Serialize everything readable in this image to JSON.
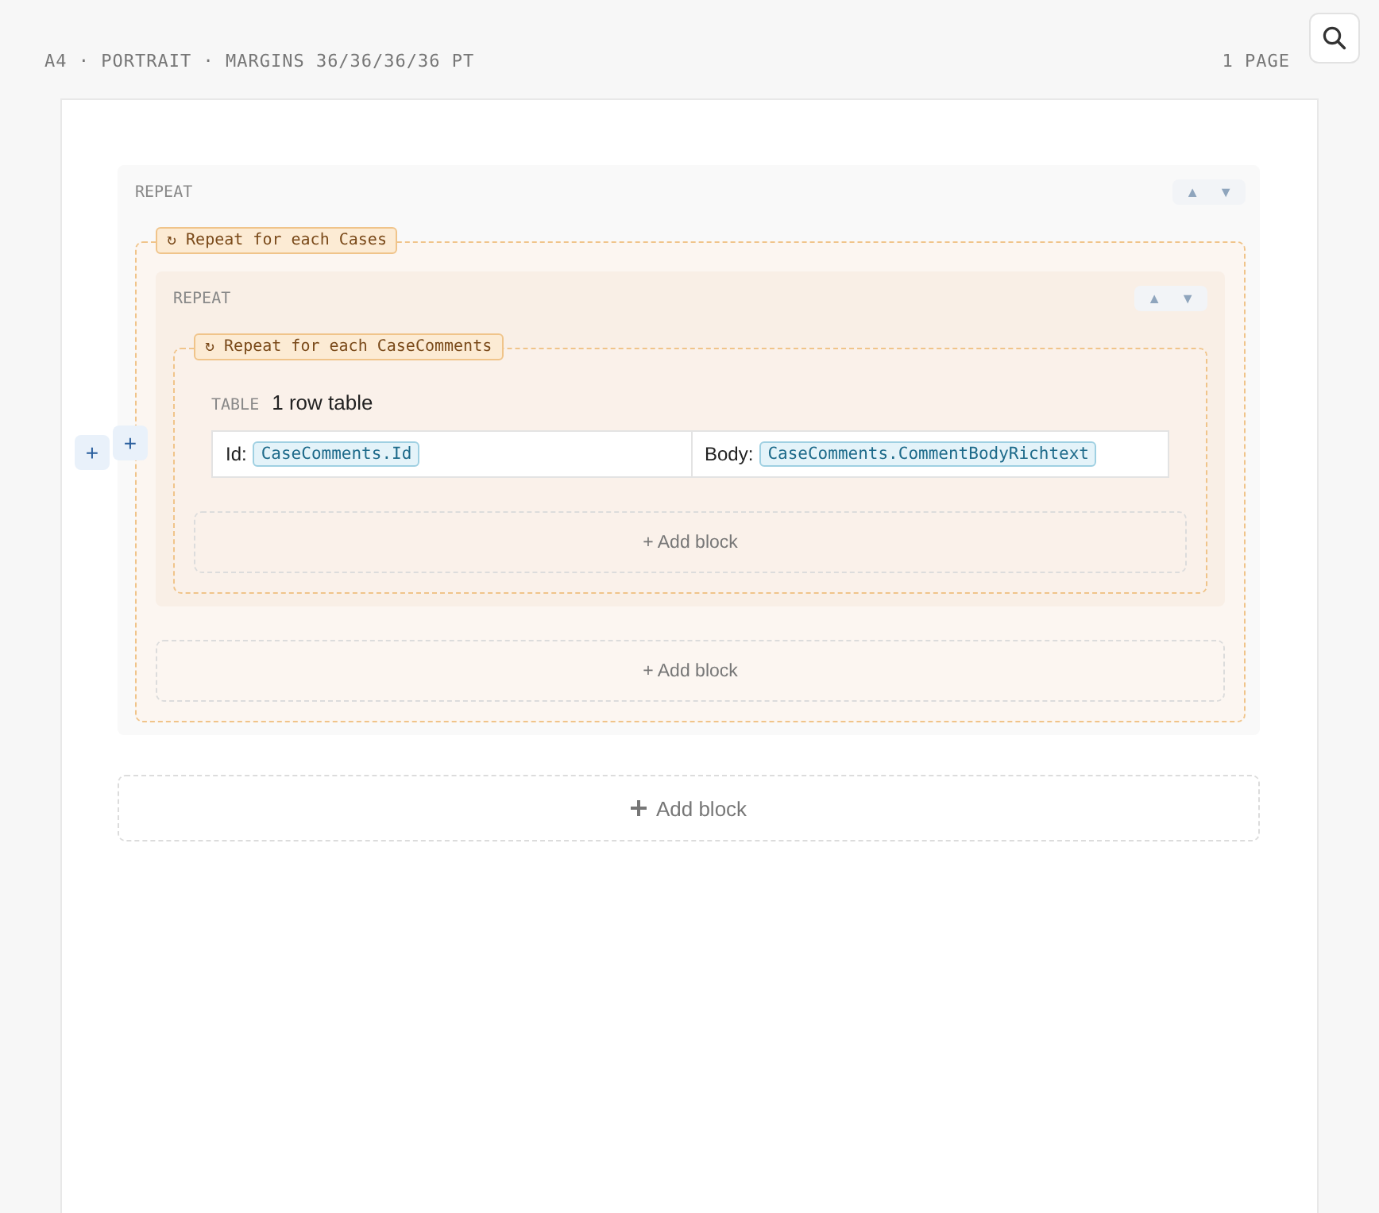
{
  "header": {
    "page_info": "A4 · PORTRAIT · MARGINS 36/36/36/36 PT",
    "page_count": "1 PAGE"
  },
  "side_handles": [
    "+",
    "+"
  ],
  "repeat": {
    "label": "REPEAT",
    "move_up": "▲",
    "move_down": "▼",
    "loop_label": "↻ Repeat for each Cases",
    "inner_repeat": {
      "label": "REPEAT",
      "move_up": "▲",
      "move_down": "▼",
      "loop_label": "↻ Repeat for each CaseComments",
      "table": {
        "kind_label": "TABLE",
        "title": "1 row table",
        "cells": [
          {
            "label": "Id:",
            "field": "CaseComments.Id"
          },
          {
            "label": "Body:",
            "field": "CaseComments.CommentBodyRichtext"
          }
        ]
      },
      "add_block": "+ Add block"
    },
    "add_block": "+ Add block"
  },
  "add_block": "Add block"
}
